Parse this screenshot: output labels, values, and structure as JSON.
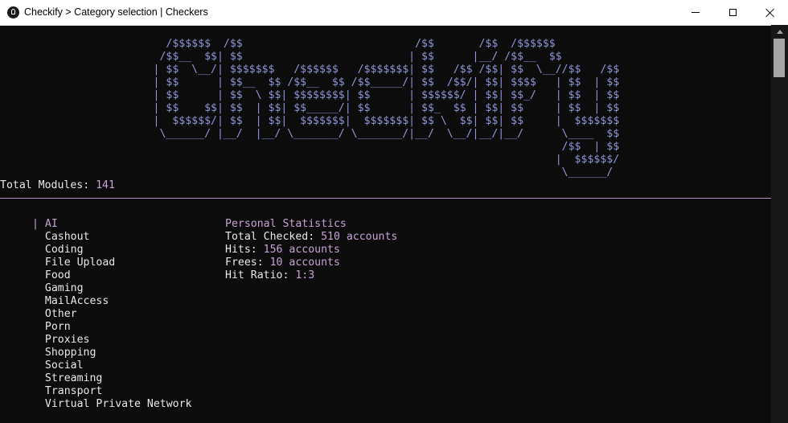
{
  "window": {
    "title": "Checkify > Category selection | Checkers"
  },
  "banner": [
    "                          /$$$$$$  /$$                           /$$       /$$  /$$$$$$",
    "                         /$$__  $$| $$                          | $$      |__/ /$$__  $$",
    "                        | $$  \\__/| $$$$$$$   /$$$$$$   /$$$$$$$| $$   /$$ /$$| $$  \\__//$$   /$$",
    "                        | $$      | $$__  $$ /$$__  $$ /$$_____/| $$  /$$/| $$| $$$$   | $$  | $$",
    "                        | $$      | $$  \\ $$| $$$$$$$$| $$      | $$$$$$/ | $$| $$_/   | $$  | $$",
    "                        | $$    $$| $$  | $$| $$_____/| $$      | $$_  $$ | $$| $$     | $$  | $$",
    "                        |  $$$$$$/| $$  | $$|  $$$$$$$|  $$$$$$$| $$ \\  $$| $$| $$     |  $$$$$$$",
    "                         \\______/ |__/  |__/ \\_______/ \\_______/|__/  \\__/|__/|__/      \\____  $$",
    "                                                                                        /$$  | $$",
    "                                                                                       |  $$$$$$/",
    "                                                                                        \\______/"
  ],
  "modules": {
    "label": "Total Modules: ",
    "count": "141"
  },
  "categories": {
    "cursor": "|",
    "items": [
      "AI",
      "Cashout",
      "Coding",
      "File Upload",
      "Food",
      "Gaming",
      "MailAccess",
      "Other",
      "Porn",
      "Proxies",
      "Shopping",
      "Social",
      "Streaming",
      "Transport",
      "Virtual Private Network"
    ]
  },
  "stats": {
    "title": "Personal Statistics",
    "rows": [
      {
        "label": "Total Checked: ",
        "value": "510 accounts"
      },
      {
        "label": "Hits: ",
        "value": "156 accounts"
      },
      {
        "label": "Frees: ",
        "value": "10 accounts"
      },
      {
        "label": "Hit Ratio: ",
        "value": "1:3"
      }
    ]
  },
  "colors": {
    "background": "#0c0c0c",
    "banner": "#8f97d9",
    "accent": "#c6a3d4",
    "text": "#e8e8e8"
  }
}
